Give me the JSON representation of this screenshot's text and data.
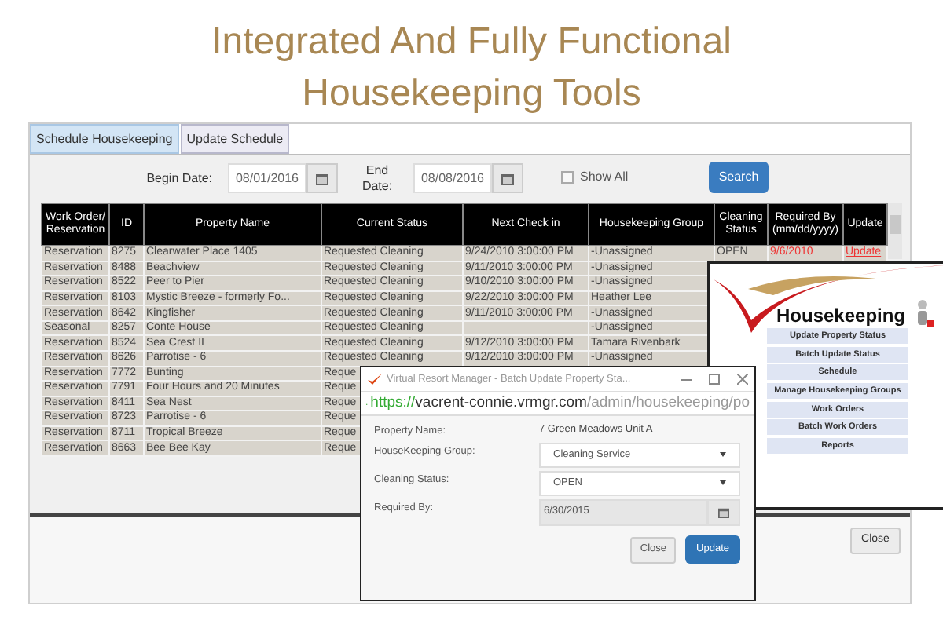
{
  "headline_lines": [
    "Integrated And Fully Functional",
    "Housekeeping Tools"
  ],
  "main_window": {
    "tabs": [
      {
        "label": "Schedule Housekeeping",
        "selected": true
      },
      {
        "label": "Update Schedule",
        "selected": false
      }
    ],
    "begin_date": {
      "label": "Begin Date:",
      "value": "08/01/2016"
    },
    "end_date": {
      "label": "End Date:",
      "value": "08/08/2016"
    },
    "show_all": {
      "label": "Show All",
      "checked": false
    },
    "search_button": "Search",
    "table": {
      "columns": [
        "Work Order/ Reservation",
        "ID",
        "Property Name",
        "Current Status",
        "Next Check in",
        "Housekeeping Group",
        "Cleaning Status",
        "Required By (mm/dd/yyyy)",
        "Update"
      ],
      "rows": [
        {
          "type": "Reservation",
          "id": "8275",
          "property": "Clearwater Place 1405",
          "status": "Requested Cleaning",
          "check_in": "9/24/2010 3:00:00 PM",
          "group": "-Unassigned",
          "cleaning_status": "OPEN",
          "required_by": "9/6/2010",
          "update": "Update"
        },
        {
          "type": "Reservation",
          "id": "8488",
          "property": "Beachview",
          "status": "Requested Cleaning",
          "check_in": "9/11/2010 3:00:00 PM",
          "group": "-Unassigned"
        },
        {
          "type": "Reservation",
          "id": "8522",
          "property": "Peer to Pier",
          "status": "Requested Cleaning",
          "check_in": "9/10/2010 3:00:00 PM",
          "group": "-Unassigned"
        },
        {
          "type": "Reservation",
          "id": "8103",
          "property": "Mystic Breeze - formerly Fo...",
          "status": "Requested Cleaning",
          "check_in": "9/22/2010 3:00:00 PM",
          "group": "Heather Lee"
        },
        {
          "type": "Reservation",
          "id": "8642",
          "property": "Kingfisher",
          "status": "Requested Cleaning",
          "check_in": "9/11/2010 3:00:00 PM",
          "group": "-Unassigned"
        },
        {
          "type": "Seasonal",
          "id": "8257",
          "property": "Conte House",
          "status": "Requested Cleaning",
          "group": "-Unassigned"
        },
        {
          "type": "Reservation",
          "id": "8524",
          "property": "Sea Crest II",
          "status": "Requested Cleaning",
          "check_in": "9/12/2010 3:00:00 PM",
          "group": "Tamara Rivenbark"
        },
        {
          "type": "Reservation",
          "id": "8626",
          "property": "Parrotise - 6",
          "status": "Requested Cleaning",
          "check_in": "9/12/2010 3:00:00 PM",
          "group": "-Unassigned"
        },
        {
          "type": "Reservation",
          "id": "7772",
          "property": "Bunting",
          "status": "Reque"
        },
        {
          "type": "Reservation",
          "id": "7791",
          "property": "Four Hours and 20 Minutes",
          "status": "Reque"
        },
        {
          "type": "Reservation",
          "id": "8411",
          "property": "Sea Nest",
          "status": "Reque"
        },
        {
          "type": "Reservation",
          "id": "8723",
          "property": "Parrotise - 6",
          "status": "Reque"
        },
        {
          "type": "Reservation",
          "id": "8711",
          "property": "Tropical Breeze",
          "status": "Reque"
        },
        {
          "type": "Reservation",
          "id": "8663",
          "property": "Bee Bee Kay",
          "status": "Reque"
        }
      ]
    },
    "close_button": "Close"
  },
  "housekeeping_window": {
    "title": "Housekeeping",
    "menu": [
      "Update Property Status",
      "Batch Update Status",
      "Schedule",
      "Manage Housekeeping Groups",
      "Work Orders",
      "Batch Work Orders",
      "Reports"
    ]
  },
  "dialog": {
    "title": "Virtual Resort Manager - Batch Update Property Sta...",
    "url": {
      "scheme": "https://",
      "host": "vacrent-connie.vrmgr.com",
      "path": "/admin/housekeeping/po"
    },
    "fields": [
      {
        "kind": "text",
        "label": "Property Name:",
        "value": "7 Green Meadows Unit A",
        "disabled": false
      },
      {
        "kind": "select",
        "label": "HouseKeeping Group:",
        "value": "Cleaning Service",
        "disabled": false
      },
      {
        "kind": "select",
        "label": "Cleaning Status:",
        "value": "OPEN",
        "disabled": false
      },
      {
        "kind": "date",
        "label": "Required By:",
        "value": "6/30/2015",
        "disabled": true
      }
    ],
    "buttons": [
      {
        "kind": "secondary",
        "label": "Close"
      },
      {
        "kind": "primary",
        "label": "Update"
      }
    ]
  }
}
